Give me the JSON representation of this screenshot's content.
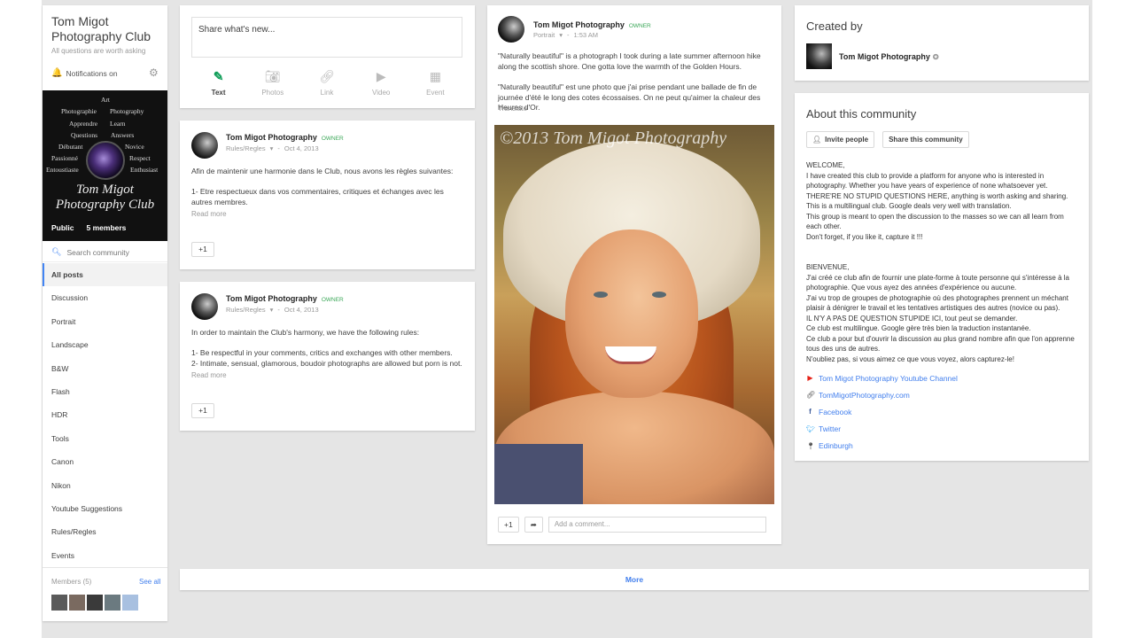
{
  "community": {
    "title": "Tom Migot Photography Club",
    "tagline": "All questions are worth asking",
    "notifications_label": "Notifications on",
    "visibility": "Public",
    "member_count": "5 members",
    "cover_brand": "Tom Migot Photography Club",
    "cover_words": [
      "Art",
      "Photographie",
      "Photography",
      "Apprendre",
      "Learn",
      "Questions",
      "Answers",
      "Débutant",
      "Novice",
      "Passionné",
      "Respect",
      "Entoustiaste",
      "Enthusiast"
    ]
  },
  "search": {
    "placeholder": "Search community"
  },
  "nav": {
    "items": [
      "All posts",
      "Discussion",
      "Portrait",
      "Landscape",
      "B&W",
      "Flash",
      "HDR",
      "Tools",
      "Canon",
      "Nikon",
      "Youtube Suggestions",
      "Rules/Regles",
      "Events"
    ]
  },
  "members": {
    "label": "Members (5)",
    "see_all": "See all"
  },
  "share": {
    "placeholder": "Share what's new...",
    "tools": [
      "Text",
      "Photos",
      "Link",
      "Video",
      "Event"
    ]
  },
  "posts": [
    {
      "author": "Tom Migot Photography",
      "badge": "OWNER",
      "category": "Rules/Regles",
      "date": "Oct 4, 2013",
      "line1": "Afin de maintenir une harmonie dans le Club, nous avons les règles suivantes:",
      "line2": "1- Etre respectueux dans vos commentaires, critiques et échanges avec les autres membres.",
      "read_more": "Read more",
      "plus_one": "+1"
    },
    {
      "author": "Tom Migot Photography",
      "badge": "OWNER",
      "category": "Rules/Regles",
      "date": "Oct 4, 2013",
      "line1": "In order to maintain the Club's harmony, we have the following rules:",
      "line2": "1- Be respectful in your comments, critics and exchanges with other members.\n2- Intimate, sensual, glamorous, boudoir photographs are allowed but porn is not.",
      "read_more": "Read more",
      "plus_one": "+1"
    },
    {
      "author": "Tom Migot Photography",
      "badge": "OWNER",
      "category": "Portrait",
      "date": "1:53 AM",
      "line1": "\"Naturally beautiful\" is a photograph I took during a late summer afternoon hike along the scottish shore. One gotta love the warmth of the Golden Hours.",
      "line2": "\"Naturally beautiful\" est une photo que j'ai prise pendant une ballade de fin de journée d'été le long des cotes écossaises. On ne peut qu'aimer la chaleur des Heures d'Or.",
      "translate": "Translate",
      "watermark": "©2013 Tom Migot Photography",
      "plus_one": "+1",
      "comment_placeholder": "Add a comment..."
    }
  ],
  "created_by": {
    "title": "Created by",
    "name": "Tom Migot Photography"
  },
  "about": {
    "title": "About this community",
    "invite": "Invite people",
    "share": "Share this community",
    "text": "WELCOME,\nI have created this club to provide a platform for anyone who is interested in photography. Whether you have years of experience of none whatsoever yet.\nTHERE'RE NO STUPID QUESTIONS HERE, anything is worth asking and sharing.\nThis is a multilingual club. Google deals very well with translation.\nThis group is meant to open the discussion to the masses so we can all learn from each other.\nDon't forget, if you like it, capture it !!!\n\n\nBIENVENUE,\nJ'ai créé ce club afin de fournir une plate-forme à toute personne qui s'intéresse à la photographie. Que vous ayez des années d'expérience ou aucune.\nJ'ai vu trop de groupes de photographie où des photographes prennent un méchant plaisir à dénigrer le travail et les tentatives artistiques des autres (novice ou pas).\nIL N'Y A PAS DE QUESTION STUPIDE ICI, tout peut se demander.\nCe club est multilingue. Google gère très bien la traduction instantanée.\nCe club a pour but d'ouvrir la discussion au plus grand nombre afin que l'on apprenne tous des uns de autres.\nN'oubliez pas, si vous aimez ce que vous voyez, alors capturez-le!",
    "links": [
      "Tom Migot Photography Youtube Channel",
      "TomMigotPhotography.com",
      "Facebook",
      "Twitter",
      "Edinburgh"
    ]
  },
  "more_label": "More",
  "colors": {
    "accent": "#427fed",
    "owner": "#3aa757",
    "active_tool": "#0f9d58"
  }
}
